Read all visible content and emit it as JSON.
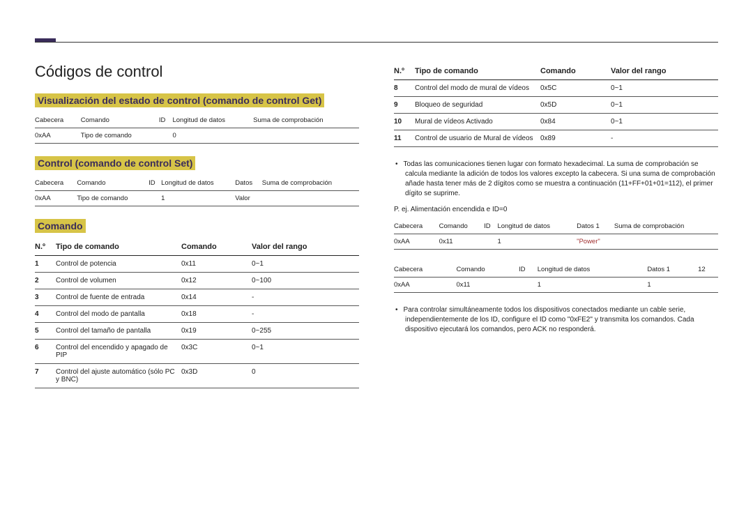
{
  "page": {
    "title": "Códigos de control"
  },
  "left": {
    "get": {
      "heading": "Visualización del estado de control (comando de control Get)",
      "h": [
        "Cabecera",
        "Comando",
        "ID",
        "Longitud de datos",
        "Suma de comprobación"
      ],
      "r1": [
        "0xAA",
        "Tipo de comando",
        "",
        "0",
        ""
      ]
    },
    "set": {
      "heading": "Control (comando de control Set)",
      "h": [
        "Cabecera",
        "Comando",
        "ID",
        "Longitud de datos",
        "Datos",
        "Suma de comprobación"
      ],
      "r1": [
        "0xAA",
        "Tipo de comando",
        "",
        "1",
        "Valor",
        ""
      ]
    },
    "cmd": {
      "heading": "Comando",
      "h": [
        "N.º",
        "Tipo de comando",
        "Comando",
        "Valor del rango"
      ],
      "rows": [
        {
          "n": "1",
          "t": "Control de potencia",
          "c": "0x11",
          "v": "0~1"
        },
        {
          "n": "2",
          "t": "Control de volumen",
          "c": "0x12",
          "v": "0~100"
        },
        {
          "n": "3",
          "t": "Control de fuente de entrada",
          "c": "0x14",
          "v": "-"
        },
        {
          "n": "4",
          "t": "Control del modo de pantalla",
          "c": "0x18",
          "v": "-"
        },
        {
          "n": "5",
          "t": "Control del tamaño de pantalla",
          "c": "0x19",
          "v": "0~255"
        },
        {
          "n": "6",
          "t": "Control del encendido y apagado de PIP",
          "c": "0x3C",
          "v": "0~1"
        },
        {
          "n": "7",
          "t": "Control del ajuste automático (sólo PC y BNC)",
          "c": "0x3D",
          "v": "0"
        }
      ]
    }
  },
  "right": {
    "cmd": {
      "h": [
        "N.º",
        "Tipo de comando",
        "Comando",
        "Valor del rango"
      ],
      "rows": [
        {
          "n": "8",
          "t": "Control del modo de mural de vídeos",
          "c": "0x5C",
          "v": "0~1"
        },
        {
          "n": "9",
          "t": "Bloqueo de seguridad",
          "c": "0x5D",
          "v": "0~1"
        },
        {
          "n": "10",
          "t": "Mural de vídeos Activado",
          "c": "0x84",
          "v": "0~1"
        },
        {
          "n": "11",
          "t": "Control de usuario de Mural de vídeos",
          "c": "0x89",
          "v": "-"
        }
      ]
    },
    "note1": "Todas las comunicaciones tienen lugar con formato hexadecimal. La suma de comprobación se calcula mediante la adición de todos los valores excepto la cabecera. Si una suma de comprobación añade hasta tener más de 2 dígitos como se muestra a continuación (11+FF+01+01=112), el primer dígito se suprime.",
    "pnote": "P. ej. Alimentación encendida e ID=0",
    "ex1": {
      "h": [
        "Cabecera",
        "Comando",
        "ID",
        "Longitud de datos",
        "Datos 1",
        "Suma de comprobación"
      ],
      "r1": [
        "0xAA",
        "0x11",
        "",
        "1",
        "\"Power\"",
        ""
      ]
    },
    "ex2": {
      "h": [
        "Cabecera",
        "Comando",
        "ID",
        "Longitud de datos",
        "Datos 1",
        "12"
      ],
      "r1": [
        "0xAA",
        "0x11",
        "",
        "1",
        "1",
        ""
      ]
    },
    "note2": "Para controlar simultáneamente todos los dispositivos conectados mediante un cable serie, independientemente de los ID, configure el ID como \"0xFE2\" y transmita los comandos. Cada dispositivo ejecutará los comandos, pero ACK no responderá."
  }
}
